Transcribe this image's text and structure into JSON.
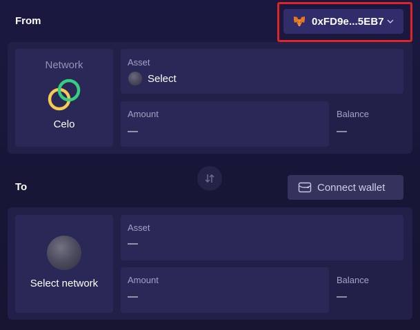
{
  "from": {
    "section_label": "From",
    "wallet": {
      "address": "0xFD9e...5EB7",
      "icon": "metamask-fox-icon"
    },
    "network": {
      "label": "Network",
      "name": "Celo",
      "icon": "celo-logo-icon"
    },
    "asset": {
      "label": "Asset",
      "value": "Select"
    },
    "amount": {
      "label": "Amount",
      "value": "—"
    },
    "balance": {
      "label": "Balance",
      "value": "—"
    }
  },
  "swap": {
    "icon": "swap-arrows-icon"
  },
  "to": {
    "section_label": "To",
    "connect_wallet": {
      "label": "Connect wallet",
      "icon": "wallet-icon"
    },
    "network": {
      "name": "Select network",
      "icon": "network-placeholder-icon"
    },
    "asset": {
      "label": "Asset",
      "value": "—"
    },
    "amount": {
      "label": "Amount",
      "value": "—"
    },
    "balance": {
      "label": "Balance",
      "value": "—"
    }
  },
  "colors": {
    "background": "#1a1840",
    "panel": "#222048",
    "card": "#2a2856",
    "highlight": "#e02424",
    "celo_yellow": "#f6c955",
    "celo_green": "#35d07f"
  }
}
